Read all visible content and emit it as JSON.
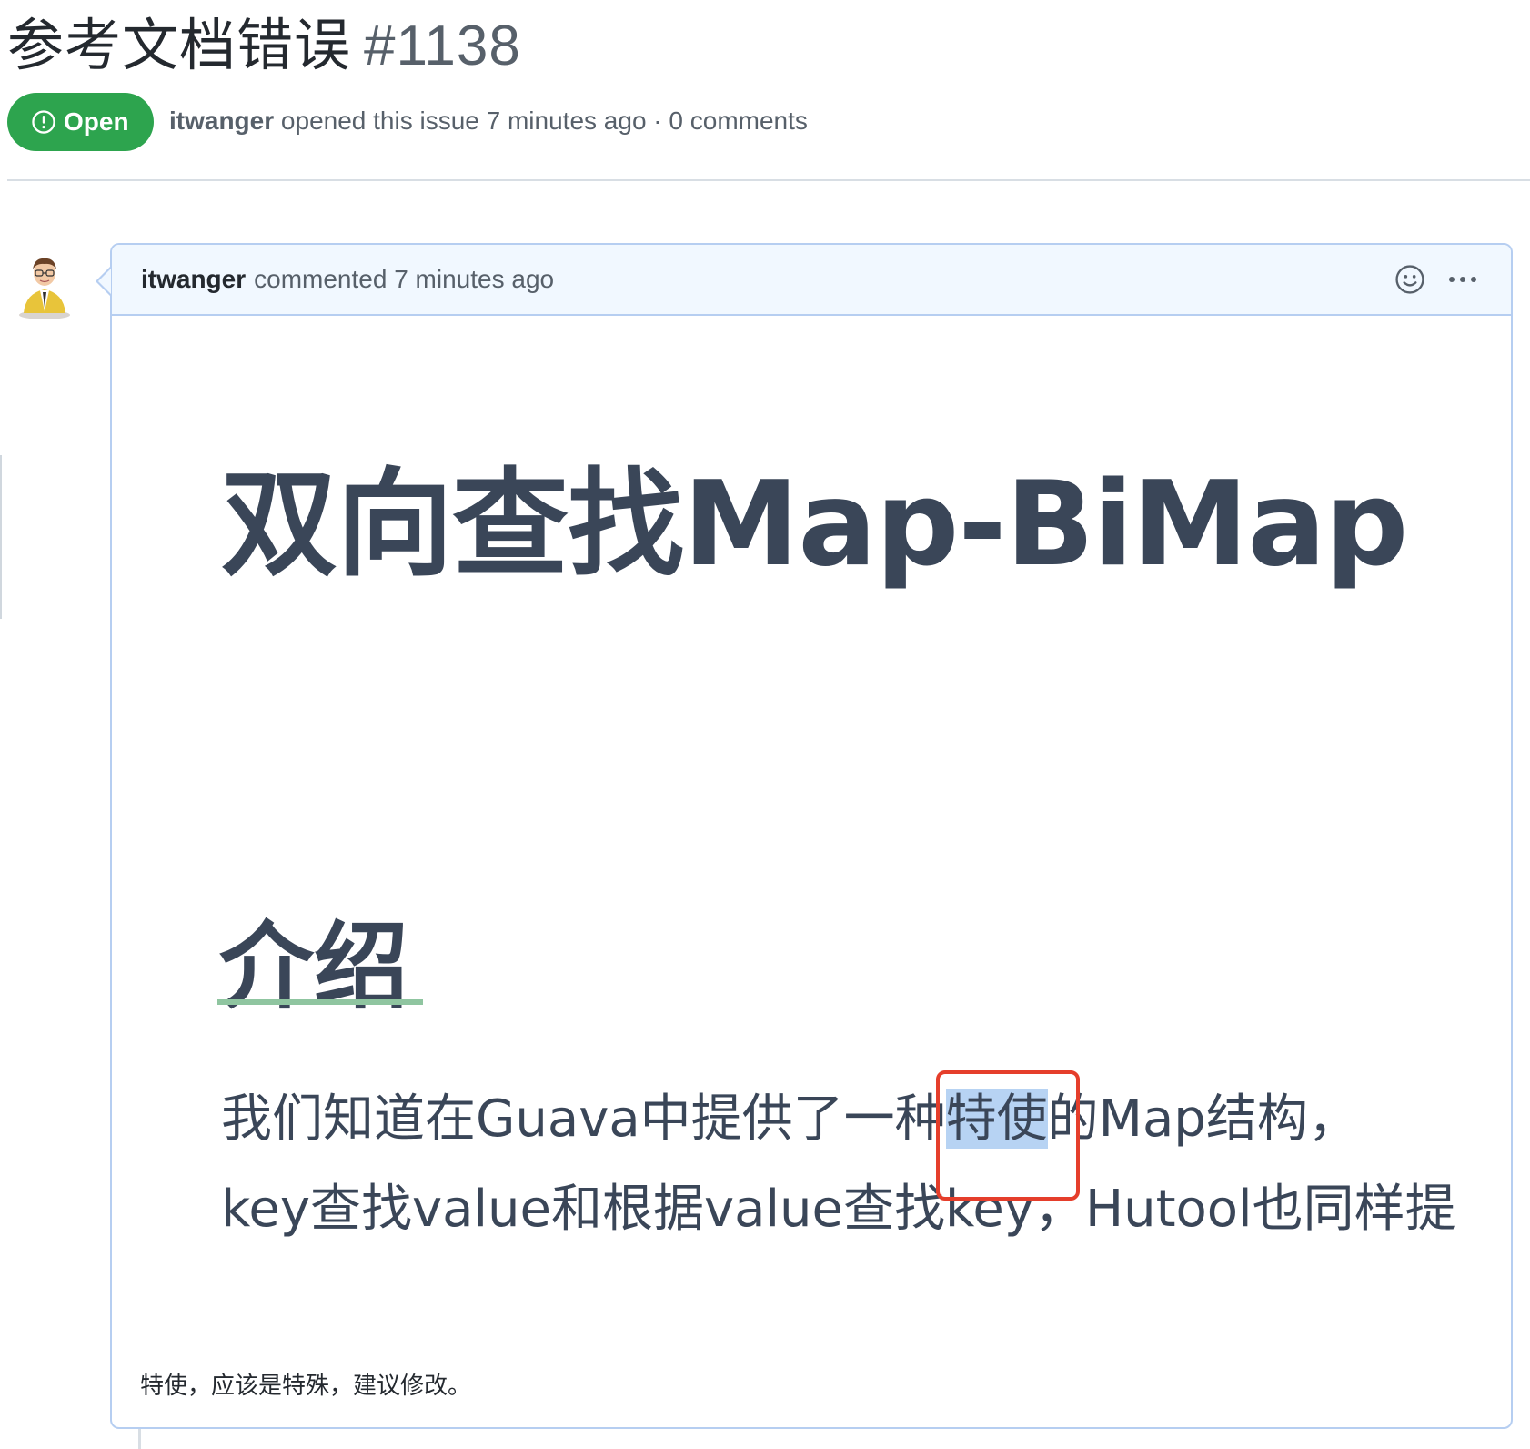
{
  "issue": {
    "title": "参考文档错误",
    "number": "#1138",
    "state": "Open",
    "author": "itwanger",
    "meta_text": "opened this issue 7 minutes ago · 0 comments"
  },
  "comment": {
    "author": "itwanger",
    "action_text": "commented 7 minutes ago",
    "screenshot": {
      "title": "双向查找Map-BiMap",
      "heading": "介绍",
      "line1_before": "我们知道在Guava中提供了一种",
      "line1_highlight": "特使",
      "line1_after": "的Map结构，",
      "line2": "key查找value和根据value查找key，Hutool也同样提"
    },
    "body_text": "特使，应该是特殊，建议修改。"
  },
  "icons": {
    "state": "issue-opened-icon",
    "reaction": "smiley-icon",
    "menu": "kebab-horizontal-icon"
  },
  "colors": {
    "open_badge": "#2da44e",
    "header_bg": "#f1f8ff",
    "border": "#b6cef1",
    "highlight": "#b7d3f3",
    "annotation": "#e53e2b"
  }
}
